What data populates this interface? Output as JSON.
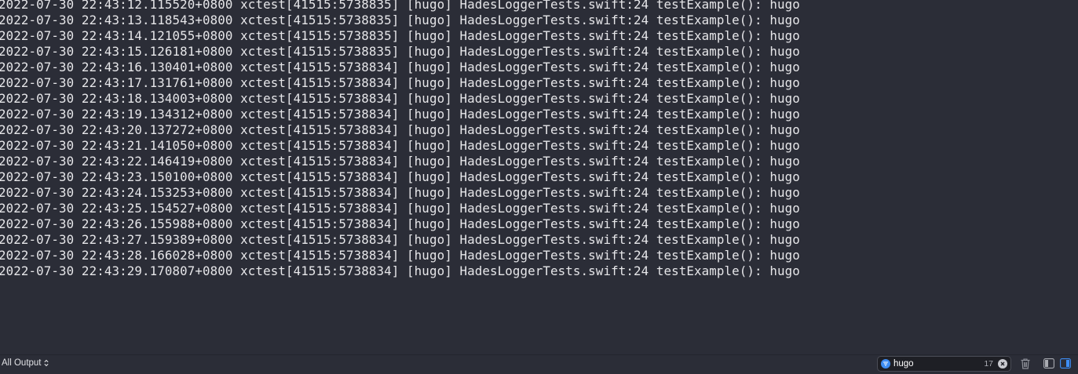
{
  "console": {
    "lines": [
      "2022-07-30 22:43:12.115520+0800 xctest[41515:5738835] [hugo] HadesLoggerTests.swift:24 testExample(): hugo",
      "2022-07-30 22:43:13.118543+0800 xctest[41515:5738835] [hugo] HadesLoggerTests.swift:24 testExample(): hugo",
      "2022-07-30 22:43:14.121055+0800 xctest[41515:5738835] [hugo] HadesLoggerTests.swift:24 testExample(): hugo",
      "2022-07-30 22:43:15.126181+0800 xctest[41515:5738835] [hugo] HadesLoggerTests.swift:24 testExample(): hugo",
      "2022-07-30 22:43:16.130401+0800 xctest[41515:5738834] [hugo] HadesLoggerTests.swift:24 testExample(): hugo",
      "2022-07-30 22:43:17.131761+0800 xctest[41515:5738834] [hugo] HadesLoggerTests.swift:24 testExample(): hugo",
      "2022-07-30 22:43:18.134003+0800 xctest[41515:5738834] [hugo] HadesLoggerTests.swift:24 testExample(): hugo",
      "2022-07-30 22:43:19.134312+0800 xctest[41515:5738834] [hugo] HadesLoggerTests.swift:24 testExample(): hugo",
      "2022-07-30 22:43:20.137272+0800 xctest[41515:5738834] [hugo] HadesLoggerTests.swift:24 testExample(): hugo",
      "2022-07-30 22:43:21.141050+0800 xctest[41515:5738834] [hugo] HadesLoggerTests.swift:24 testExample(): hugo",
      "2022-07-30 22:43:22.146419+0800 xctest[41515:5738834] [hugo] HadesLoggerTests.swift:24 testExample(): hugo",
      "2022-07-30 22:43:23.150100+0800 xctest[41515:5738834] [hugo] HadesLoggerTests.swift:24 testExample(): hugo",
      "2022-07-30 22:43:24.153253+0800 xctest[41515:5738834] [hugo] HadesLoggerTests.swift:24 testExample(): hugo",
      "2022-07-30 22:43:25.154527+0800 xctest[41515:5738834] [hugo] HadesLoggerTests.swift:24 testExample(): hugo",
      "2022-07-30 22:43:26.155988+0800 xctest[41515:5738834] [hugo] HadesLoggerTests.swift:24 testExample(): hugo",
      "2022-07-30 22:43:27.159389+0800 xctest[41515:5738834] [hugo] HadesLoggerTests.swift:24 testExample(): hugo",
      "2022-07-30 22:43:28.166028+0800 xctest[41515:5738834] [hugo] HadesLoggerTests.swift:24 testExample(): hugo",
      "2022-07-30 22:43:29.170807+0800 xctest[41515:5738834] [hugo] HadesLoggerTests.swift:24 testExample(): hugo"
    ]
  },
  "bottom_bar": {
    "output_selector": {
      "label": "All Output",
      "icon": "chevron-updown-icon"
    },
    "filter": {
      "value": "hugo",
      "match_count": "17",
      "icon": "filter-icon",
      "clear_icon": "clear-icon"
    },
    "trash_icon": "trash-icon",
    "toggle_left_icon": "left-panel-toggle-icon",
    "toggle_right_icon": "right-panel-toggle-icon"
  },
  "colors": {
    "background": "#2b2d37",
    "text": "#e6e6e9",
    "accent": "#3d8df5"
  }
}
